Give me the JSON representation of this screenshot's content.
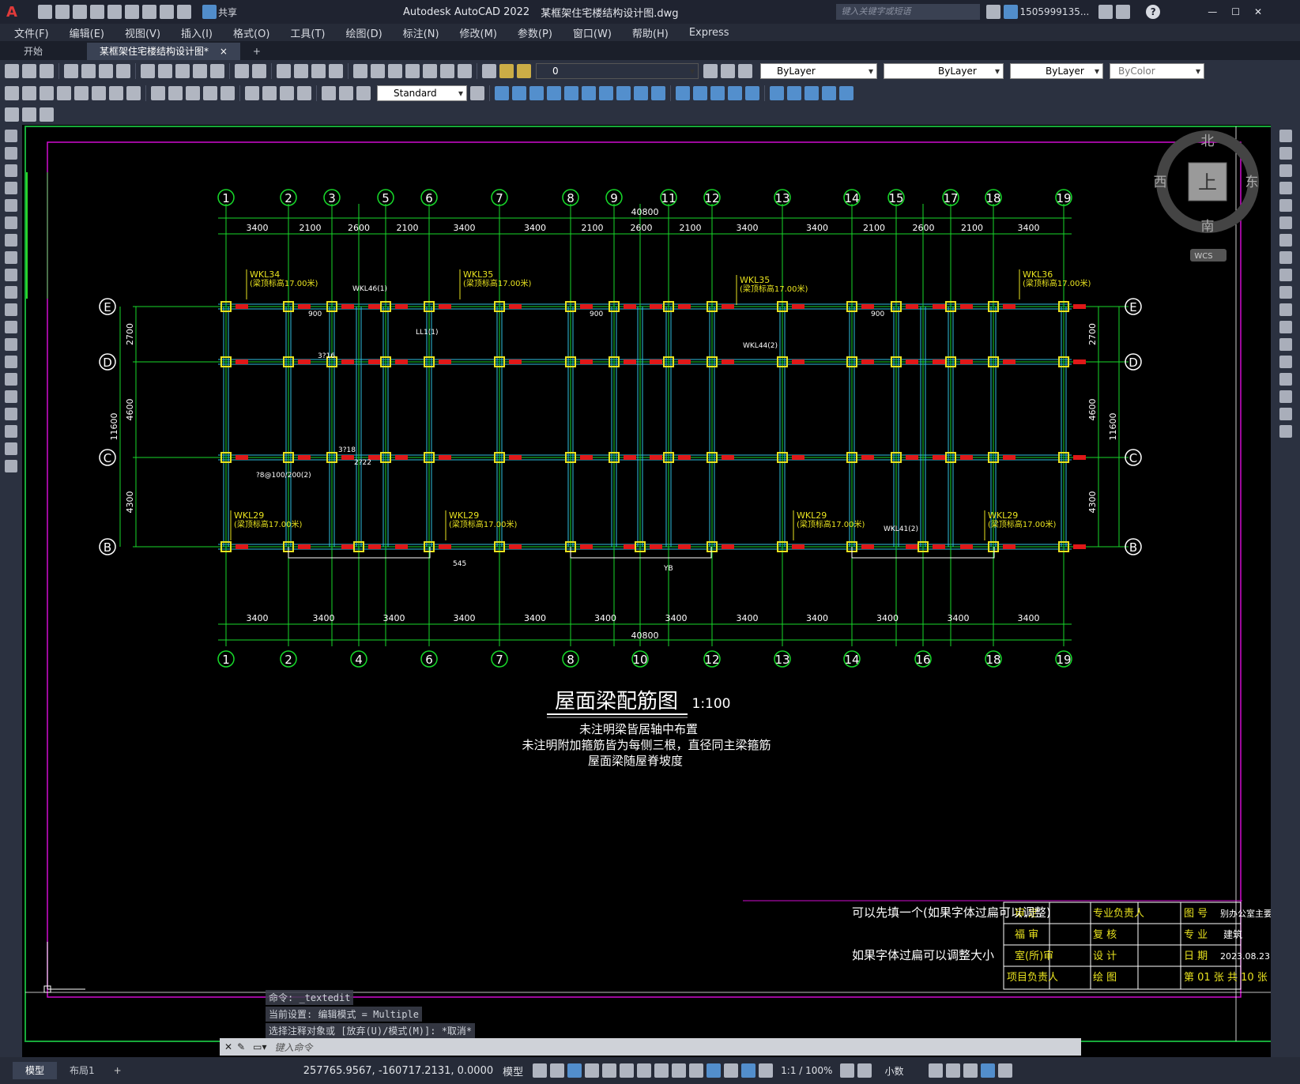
{
  "titlebar": {
    "app_letter": "A",
    "share_label": "共享",
    "app_title": "Autodesk AutoCAD 2022",
    "file_title": "某框架住宅楼结构设计图.dwg",
    "search_placeholder": "键入关键字或短语",
    "user_name": "1505999135...",
    "help": "?"
  },
  "menubar": {
    "items": [
      "文件(F)",
      "编辑(E)",
      "视图(V)",
      "插入(I)",
      "格式(O)",
      "工具(T)",
      "绘图(D)",
      "标注(N)",
      "修改(M)",
      "参数(P)",
      "窗口(W)",
      "帮助(H)",
      "Express"
    ]
  },
  "tabs": {
    "start": "开始",
    "drawing": "某框架住宅楼结构设计图*",
    "close": "×",
    "add": "+"
  },
  "toolbar": {
    "layer_value": "0",
    "color_value": "ByLayer",
    "linetype_value": "ByLayer",
    "lineweight_value": "ByLayer",
    "plotstyle_value": "ByColor",
    "textstyle_value": "Standard"
  },
  "viewcube": {
    "north": "北",
    "south": "南",
    "east": "东",
    "west": "西",
    "top": "上",
    "wcs": "WCS"
  },
  "drawing": {
    "top_axes": [
      "1",
      "2",
      "3",
      "5",
      "6",
      "7",
      "8",
      "9",
      "11",
      "12",
      "13",
      "14",
      "15",
      "17",
      "18",
      "19"
    ],
    "bottom_axes": [
      "1",
      "2",
      "4",
      "6",
      "7",
      "8",
      "10",
      "12",
      "13",
      "14",
      "16",
      "18",
      "19"
    ],
    "row_axes": [
      "E",
      "D",
      "C",
      "B"
    ],
    "total_dim": "40800",
    "top_dims": [
      "3400",
      "2100",
      "2600",
      "2100",
      "3400",
      "3400",
      "2100",
      "2600",
      "2100",
      "3400",
      "3400",
      "2100",
      "2600",
      "2100",
      "3400"
    ],
    "bottom_dims": [
      "3400",
      "3400",
      "3400",
      "3400",
      "3400",
      "3400",
      "3400",
      "3400",
      "3400",
      "3400",
      "3400",
      "3400"
    ],
    "left_dims": [
      "2700",
      "4600",
      "4300"
    ],
    "left_total": "11600",
    "beam_labels": [
      "WKL34",
      "WKL35",
      "WKL35",
      "WKL36",
      "WKL29",
      "WKL29",
      "WKL29",
      "WKL29"
    ],
    "elev_note": "(梁顶标高17.00米)",
    "small_labels": [
      "900",
      "900",
      "900",
      "3?16",
      "3?18",
      "2?22",
      "?8@100/200(2)",
      "WKL46(1)",
      "WKL44(2)",
      "WKL41(2)",
      "LL1(1)",
      "545",
      "YB"
    ],
    "title": "屋面梁配筋图",
    "scale": "1:100",
    "notes": [
      "未注明梁皆居轴中布置",
      "未注明附加箍筋皆为每侧三根，直径同主梁箍筋",
      "屋面梁随屋脊坡度"
    ]
  },
  "titleblock": {
    "overlay1": "可以先填一个(如果字体过扁可以调整)",
    "overlay2": "如果字体过扁可以调整大小",
    "cells": [
      "审  定",
      "专业负责人",
      "图  号",
      "别办公室主要",
      "福  审",
      "复  核",
      "专  业",
      "建筑",
      "室(所)审",
      "设  计",
      "日  期",
      "2023.08.23",
      "项目负责人",
      "绘  图",
      "第 01 张  共 10 张"
    ]
  },
  "command": {
    "history": [
      "命令: _textedit",
      "当前设置: 编辑模式 = Multiple",
      "选择注释对象或 [放弃(U)/模式(M)]: *取消*"
    ],
    "placeholder": "键入命令"
  },
  "statusbar": {
    "tab_model": "模型",
    "tab_layout": "布局1",
    "coords": "257765.9567, -160717.2131, 0.0000",
    "model_btn": "模型",
    "scale": "1:1 / 100%",
    "units": "小数"
  }
}
